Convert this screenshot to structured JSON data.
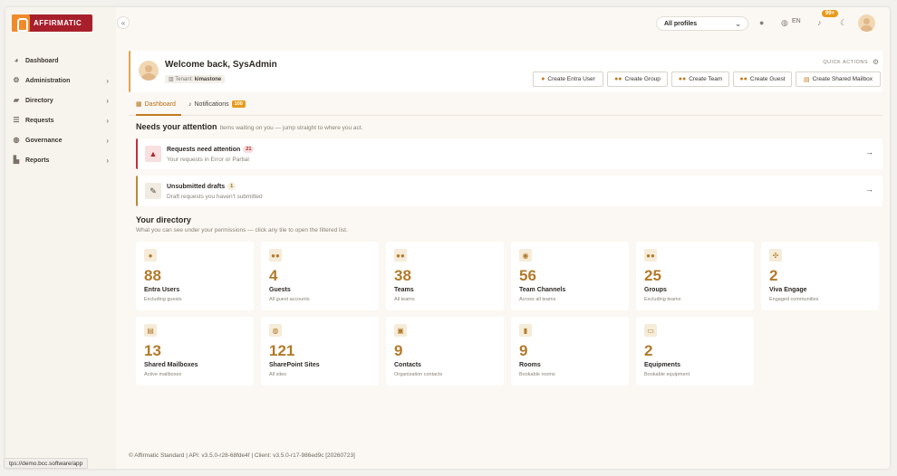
{
  "app": {
    "logo_text": "AFFIRMATIC"
  },
  "sidebar": {
    "items": [
      {
        "label": "Dashboard",
        "icon": "palette-icon",
        "has_chevron": false
      },
      {
        "label": "Administration",
        "icon": "person-gear-icon",
        "has_chevron": true
      },
      {
        "label": "Directory",
        "icon": "folder-icon",
        "has_chevron": true
      },
      {
        "label": "Requests",
        "icon": "list-icon",
        "has_chevron": true
      },
      {
        "label": "Governance",
        "icon": "globe-shield-icon",
        "has_chevron": true
      },
      {
        "label": "Reports",
        "icon": "chart-icon",
        "has_chevron": true
      }
    ]
  },
  "topbar": {
    "profile_select": "All profiles",
    "language": "EN",
    "notifications_badge": "99+"
  },
  "welcome": {
    "title": "Welcome back, SysAdmin",
    "tenant_label": "Tenant:",
    "tenant_value": "kimastone",
    "quick_actions_label": "QUICK ACTIONS",
    "actions": [
      {
        "label": "Create Entra User"
      },
      {
        "label": "Create Group"
      },
      {
        "label": "Create Team"
      },
      {
        "label": "Create Guest"
      },
      {
        "label": "Create Shared Mailbox"
      }
    ]
  },
  "tabs": [
    {
      "label": "Dashboard",
      "active": true
    },
    {
      "label": "Notifications",
      "badge": "100",
      "active": false
    }
  ],
  "attention": {
    "title": "Needs your attention",
    "subtitle": "Items waiting on you — jump straight to where you act.",
    "items": [
      {
        "title": "Requests need attention",
        "count": "21",
        "desc": "Your requests in Error or Partial"
      },
      {
        "title": "Unsubmitted drafts",
        "count": "1",
        "desc": "Draft requests you haven't submitted"
      }
    ]
  },
  "directory": {
    "title": "Your directory",
    "subtitle": "What you can see under your permissions — click any tile to open the filtered list.",
    "tiles": [
      {
        "value": "88",
        "label": "Entra Users",
        "sub": "Excluding guests",
        "icon": "user-icon"
      },
      {
        "value": "4",
        "label": "Guests",
        "sub": "All guest accounts",
        "icon": "users-icon"
      },
      {
        "value": "38",
        "label": "Teams",
        "sub": "All teams",
        "icon": "team-icon"
      },
      {
        "value": "56",
        "label": "Team Channels",
        "sub": "Across all teams",
        "icon": "chat-icon"
      },
      {
        "value": "25",
        "label": "Groups",
        "sub": "Excluding teams",
        "icon": "group-icon"
      },
      {
        "value": "2",
        "label": "Viva Engage",
        "sub": "Engaged communities",
        "icon": "network-icon"
      },
      {
        "value": "13",
        "label": "Shared Mailboxes",
        "sub": "Active mailboxes",
        "icon": "mailbox-icon"
      },
      {
        "value": "121",
        "label": "SharePoint Sites",
        "sub": "All sites",
        "icon": "globe-icon"
      },
      {
        "value": "9",
        "label": "Contacts",
        "sub": "Organization contacts",
        "icon": "contact-card-icon"
      },
      {
        "value": "9",
        "label": "Rooms",
        "sub": "Bookable rooms",
        "icon": "door-icon"
      },
      {
        "value": "2",
        "label": "Equipments",
        "sub": "Bookable equipment",
        "icon": "monitor-icon"
      }
    ]
  },
  "footer": "© Affirmatic Standard | API: v3.5.0-r28-68fde4f | Client: v3.5.0-r17-986ed9c [20260723]",
  "statusbar": "tps://demo.bcc.software/app",
  "colors": {
    "accent": "#c47a1e",
    "brand": "#a81f2c",
    "alert": "#c0303a"
  }
}
